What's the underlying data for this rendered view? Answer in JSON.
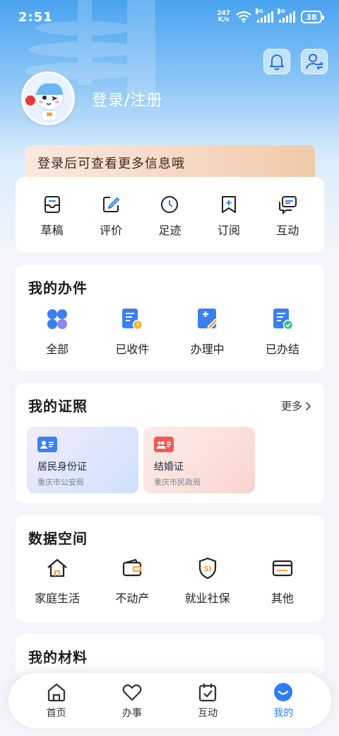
{
  "status_bar": {
    "time": "2:51",
    "net_speed_value": "247",
    "net_speed_unit": "K/s",
    "sig1_label": "5G",
    "sig2_label": "4G",
    "battery": "38"
  },
  "profile": {
    "login_title": "登录/注册",
    "banner_text": "登录后可查看更多信息哦"
  },
  "quick_actions": [
    {
      "label": "草稿",
      "icon": "draft-icon"
    },
    {
      "label": "评价",
      "icon": "edit-icon"
    },
    {
      "label": "足迹",
      "icon": "clock-icon"
    },
    {
      "label": "订阅",
      "icon": "bookmark-plus-icon"
    },
    {
      "label": "互动",
      "icon": "chat-icon"
    }
  ],
  "my_tasks": {
    "title": "我的办件",
    "items": [
      {
        "label": "全部",
        "icon": "all-grid-icon"
      },
      {
        "label": "已收件",
        "icon": "received-doc-icon"
      },
      {
        "label": "办理中",
        "icon": "processing-doc-icon"
      },
      {
        "label": "已办结",
        "icon": "completed-doc-icon"
      }
    ]
  },
  "my_licenses": {
    "title": "我的证照",
    "more": "更多",
    "cards": [
      {
        "name": "居民身份证",
        "org": "重庆市公安局",
        "accent": "#3b7ff0"
      },
      {
        "name": "结婚证",
        "org": "重庆市民政局",
        "accent": "#ef5a56"
      }
    ]
  },
  "data_space": {
    "title": "数据空间",
    "items": [
      {
        "label": "家庭生活",
        "icon": "house-icon"
      },
      {
        "label": "不动产",
        "icon": "wallet-icon"
      },
      {
        "label": "就业社保",
        "icon": "shield-si-icon"
      },
      {
        "label": "其他",
        "icon": "card-icon"
      }
    ]
  },
  "my_materials": {
    "title": "我的材料"
  },
  "tabbar": {
    "tabs": [
      {
        "label": "首页",
        "icon": "home-icon"
      },
      {
        "label": "办事",
        "icon": "heart-icon"
      },
      {
        "label": "互动",
        "icon": "calendar-check-icon"
      },
      {
        "label": "我的",
        "icon": "smile-icon",
        "active": true
      }
    ]
  },
  "colors": {
    "primary": "#2f7ef7",
    "banner_text": "#3b2c22"
  }
}
